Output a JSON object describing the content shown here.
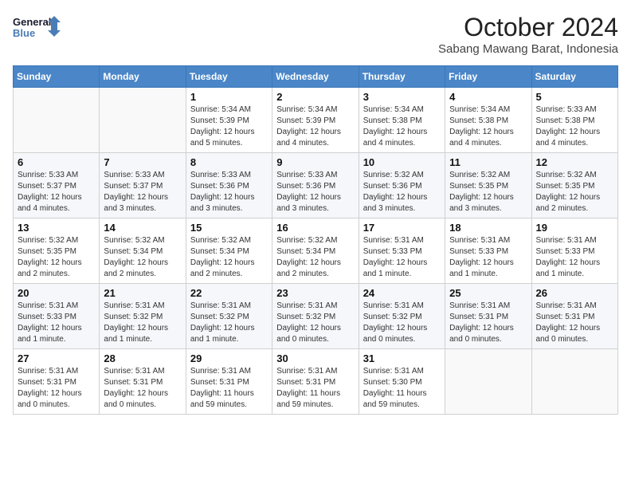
{
  "logo": {
    "line1": "General",
    "line2": "Blue"
  },
  "title": "October 2024",
  "subtitle": "Sabang Mawang Barat, Indonesia",
  "days_of_week": [
    "Sunday",
    "Monday",
    "Tuesday",
    "Wednesday",
    "Thursday",
    "Friday",
    "Saturday"
  ],
  "weeks": [
    [
      {
        "day": "",
        "info": ""
      },
      {
        "day": "",
        "info": ""
      },
      {
        "day": "1",
        "info": "Sunrise: 5:34 AM\nSunset: 5:39 PM\nDaylight: 12 hours and 5 minutes."
      },
      {
        "day": "2",
        "info": "Sunrise: 5:34 AM\nSunset: 5:39 PM\nDaylight: 12 hours and 4 minutes."
      },
      {
        "day": "3",
        "info": "Sunrise: 5:34 AM\nSunset: 5:38 PM\nDaylight: 12 hours and 4 minutes."
      },
      {
        "day": "4",
        "info": "Sunrise: 5:34 AM\nSunset: 5:38 PM\nDaylight: 12 hours and 4 minutes."
      },
      {
        "day": "5",
        "info": "Sunrise: 5:33 AM\nSunset: 5:38 PM\nDaylight: 12 hours and 4 minutes."
      }
    ],
    [
      {
        "day": "6",
        "info": "Sunrise: 5:33 AM\nSunset: 5:37 PM\nDaylight: 12 hours and 4 minutes."
      },
      {
        "day": "7",
        "info": "Sunrise: 5:33 AM\nSunset: 5:37 PM\nDaylight: 12 hours and 3 minutes."
      },
      {
        "day": "8",
        "info": "Sunrise: 5:33 AM\nSunset: 5:36 PM\nDaylight: 12 hours and 3 minutes."
      },
      {
        "day": "9",
        "info": "Sunrise: 5:33 AM\nSunset: 5:36 PM\nDaylight: 12 hours and 3 minutes."
      },
      {
        "day": "10",
        "info": "Sunrise: 5:32 AM\nSunset: 5:36 PM\nDaylight: 12 hours and 3 minutes."
      },
      {
        "day": "11",
        "info": "Sunrise: 5:32 AM\nSunset: 5:35 PM\nDaylight: 12 hours and 3 minutes."
      },
      {
        "day": "12",
        "info": "Sunrise: 5:32 AM\nSunset: 5:35 PM\nDaylight: 12 hours and 2 minutes."
      }
    ],
    [
      {
        "day": "13",
        "info": "Sunrise: 5:32 AM\nSunset: 5:35 PM\nDaylight: 12 hours and 2 minutes."
      },
      {
        "day": "14",
        "info": "Sunrise: 5:32 AM\nSunset: 5:34 PM\nDaylight: 12 hours and 2 minutes."
      },
      {
        "day": "15",
        "info": "Sunrise: 5:32 AM\nSunset: 5:34 PM\nDaylight: 12 hours and 2 minutes."
      },
      {
        "day": "16",
        "info": "Sunrise: 5:32 AM\nSunset: 5:34 PM\nDaylight: 12 hours and 2 minutes."
      },
      {
        "day": "17",
        "info": "Sunrise: 5:31 AM\nSunset: 5:33 PM\nDaylight: 12 hours and 1 minute."
      },
      {
        "day": "18",
        "info": "Sunrise: 5:31 AM\nSunset: 5:33 PM\nDaylight: 12 hours and 1 minute."
      },
      {
        "day": "19",
        "info": "Sunrise: 5:31 AM\nSunset: 5:33 PM\nDaylight: 12 hours and 1 minute."
      }
    ],
    [
      {
        "day": "20",
        "info": "Sunrise: 5:31 AM\nSunset: 5:33 PM\nDaylight: 12 hours and 1 minute."
      },
      {
        "day": "21",
        "info": "Sunrise: 5:31 AM\nSunset: 5:32 PM\nDaylight: 12 hours and 1 minute."
      },
      {
        "day": "22",
        "info": "Sunrise: 5:31 AM\nSunset: 5:32 PM\nDaylight: 12 hours and 1 minute."
      },
      {
        "day": "23",
        "info": "Sunrise: 5:31 AM\nSunset: 5:32 PM\nDaylight: 12 hours and 0 minutes."
      },
      {
        "day": "24",
        "info": "Sunrise: 5:31 AM\nSunset: 5:32 PM\nDaylight: 12 hours and 0 minutes."
      },
      {
        "day": "25",
        "info": "Sunrise: 5:31 AM\nSunset: 5:31 PM\nDaylight: 12 hours and 0 minutes."
      },
      {
        "day": "26",
        "info": "Sunrise: 5:31 AM\nSunset: 5:31 PM\nDaylight: 12 hours and 0 minutes."
      }
    ],
    [
      {
        "day": "27",
        "info": "Sunrise: 5:31 AM\nSunset: 5:31 PM\nDaylight: 12 hours and 0 minutes."
      },
      {
        "day": "28",
        "info": "Sunrise: 5:31 AM\nSunset: 5:31 PM\nDaylight: 12 hours and 0 minutes."
      },
      {
        "day": "29",
        "info": "Sunrise: 5:31 AM\nSunset: 5:31 PM\nDaylight: 11 hours and 59 minutes."
      },
      {
        "day": "30",
        "info": "Sunrise: 5:31 AM\nSunset: 5:31 PM\nDaylight: 11 hours and 59 minutes."
      },
      {
        "day": "31",
        "info": "Sunrise: 5:31 AM\nSunset: 5:30 PM\nDaylight: 11 hours and 59 minutes."
      },
      {
        "day": "",
        "info": ""
      },
      {
        "day": "",
        "info": ""
      }
    ]
  ]
}
